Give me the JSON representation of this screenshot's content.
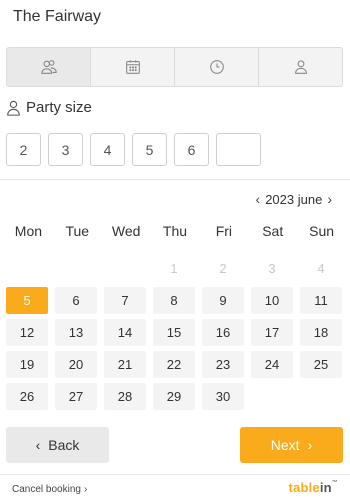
{
  "header": {
    "title": "The Fairway"
  },
  "steps": [
    {
      "icon": "people-icon"
    },
    {
      "icon": "calendar-icon"
    },
    {
      "icon": "clock-icon"
    },
    {
      "icon": "person-icon"
    }
  ],
  "party": {
    "label": "Party size",
    "options": [
      "2",
      "3",
      "4",
      "5",
      "6"
    ],
    "custom_value": ""
  },
  "calendar": {
    "month_label": "2023 june",
    "prev_arrow": "‹",
    "next_arrow": "›",
    "weekdays": [
      "Mon",
      "Tue",
      "Wed",
      "Thu",
      "Fri",
      "Sat",
      "Sun"
    ],
    "disabled_days": [
      "",
      "",
      "",
      "1",
      "2",
      "3",
      "4"
    ],
    "selected_day": "5",
    "days": [
      "6",
      "7",
      "8",
      "9",
      "10",
      "11",
      "12",
      "13",
      "14",
      "15",
      "16",
      "17",
      "18",
      "19",
      "20",
      "21",
      "22",
      "23",
      "24",
      "25",
      "26",
      "27",
      "28",
      "29",
      "30"
    ]
  },
  "buttons": {
    "back_label": "Back",
    "back_arrow": "‹",
    "next_label": "Next",
    "next_arrow": "›"
  },
  "footer": {
    "cancel_label": "Cancel booking",
    "cancel_arrow": "›",
    "brand_table": "table",
    "brand_in": "in",
    "brand_tm": "™"
  },
  "colors": {
    "accent": "#f9ab1b",
    "step_bg": "#f3f3f3",
    "day_bg": "#f4f4f4"
  }
}
